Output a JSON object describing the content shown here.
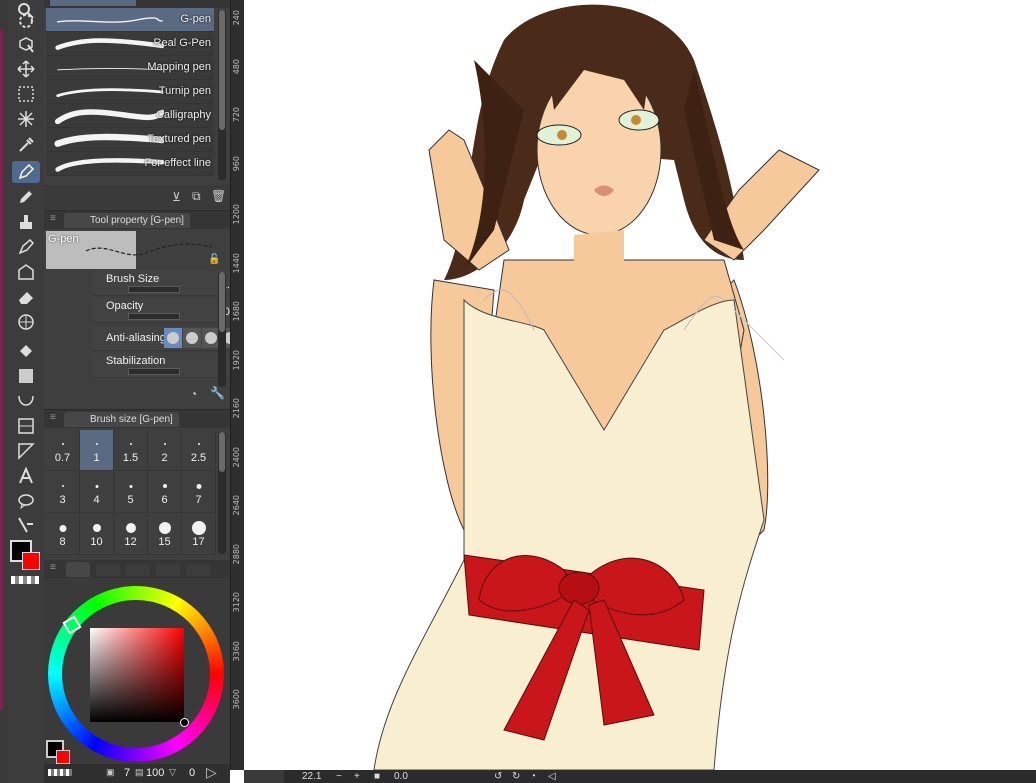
{
  "brush_list": {
    "items": [
      {
        "label": "G-pen",
        "selected": true
      },
      {
        "label": "Real G-Pen",
        "selected": false
      },
      {
        "label": "Mapping pen",
        "selected": false
      },
      {
        "label": "Turnip pen",
        "selected": false
      },
      {
        "label": "Calligraphy",
        "selected": false
      },
      {
        "label": "Textured pen",
        "selected": false
      },
      {
        "label": "For effect line",
        "selected": false
      }
    ]
  },
  "tool_property": {
    "tab_title": "Tool property [G-pen]",
    "preview_label": "G-pen",
    "rows": [
      {
        "name": "Brush Size",
        "value": "1.0"
      },
      {
        "name": "Opacity",
        "value": "100"
      },
      {
        "name": "Anti-aliasing",
        "value": ""
      },
      {
        "name": "Stabilization",
        "value": "11"
      }
    ]
  },
  "brush_size": {
    "tab_title": "Brush size [G-pen]",
    "sizes": [
      "0.7",
      "1",
      "1.5",
      "2",
      "2.5",
      "3",
      "4",
      "5",
      "6",
      "7",
      "8",
      "10",
      "12",
      "15",
      "17"
    ],
    "selected": "1"
  },
  "ruler": {
    "ticks": [
      "240",
      "480",
      "720",
      "960",
      "1200",
      "1440",
      "1680",
      "1920",
      "2160",
      "2400",
      "2640",
      "2880",
      "3120",
      "3360",
      "3600"
    ]
  },
  "color_footer": {
    "layer_count": "7",
    "opacity": "100",
    "extra": "0"
  },
  "status_bar": {
    "zoom": "22.1",
    "angle": "0.0"
  },
  "colors": {
    "main_color": "#000000",
    "sub_color": "#ff0000",
    "panel_bg": "#3f3f3f",
    "selection": "#5a6a82",
    "ribbon_red": "#c8161a",
    "dress_cream": "#f7efcf",
    "skin": "#f6c99a",
    "hair": "#4a2a18"
  },
  "icons": [
    "zoom-icon",
    "lasso-select-icon",
    "object-icon",
    "move-icon",
    "rect-select-icon",
    "auto-select-icon",
    "eyedropper-icon",
    "pen-icon",
    "pencil-icon",
    "brush-icon",
    "ink-icon",
    "decorate-icon",
    "eraser-icon",
    "mesh-icon",
    "fill-icon",
    "gradient-icon",
    "curve-icon",
    "frame-icon",
    "ruler-icon",
    "text-icon",
    "balloon-icon",
    "correct-line-icon"
  ]
}
